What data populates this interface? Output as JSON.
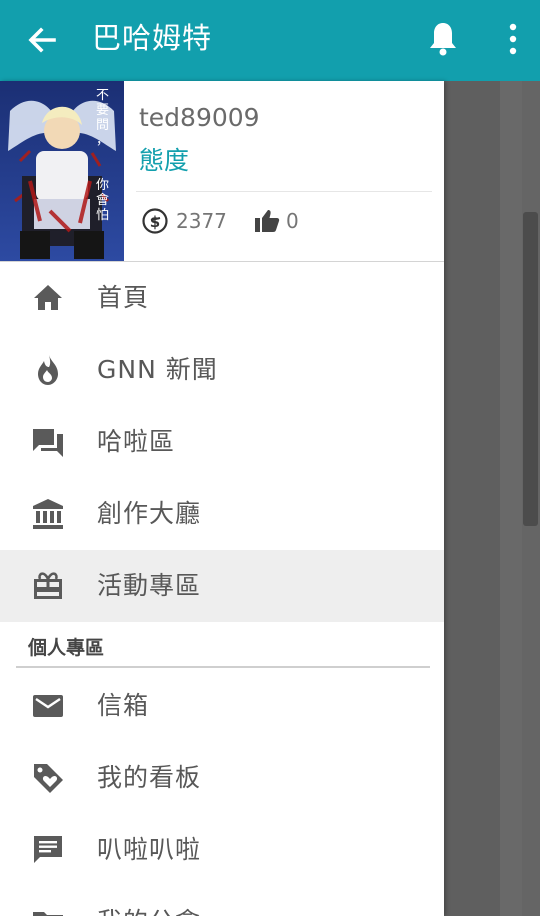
{
  "app_bar": {
    "title": "巴哈姆特",
    "back_icon": "arrow-left-icon",
    "notification_icon": "bell-icon",
    "more_icon": "more-vertical-icon",
    "color": "#129fad"
  },
  "profile": {
    "username": "ted89009",
    "nickname": "態度",
    "coins": "2377",
    "likes": "0",
    "coin_icon": "coin-dollar-icon",
    "like_icon": "thumb-up-icon",
    "avatar_text": "不要問，你會怕"
  },
  "menu": [
    {
      "label": "首頁",
      "icon": "home-icon"
    },
    {
      "label": "GNN 新聞",
      "icon": "fire-icon"
    },
    {
      "label": "哈啦區",
      "icon": "forum-icon"
    },
    {
      "label": "創作大廳",
      "icon": "bank-icon"
    },
    {
      "label": "活動專區",
      "icon": "gift-box-icon",
      "active": true
    }
  ],
  "personal_section": {
    "title": "個人專區",
    "items": [
      {
        "label": "信箱",
        "icon": "mail-icon"
      },
      {
        "label": "我的看板",
        "icon": "tag-heart-icon"
      },
      {
        "label": "叭啦叭啦",
        "icon": "chat-icon"
      },
      {
        "label": "我的公會",
        "icon": "folder-icon"
      }
    ]
  },
  "colors": {
    "accent": "#129fad",
    "active_row": "#eeeeee",
    "scrim": "#5f5f5f"
  }
}
